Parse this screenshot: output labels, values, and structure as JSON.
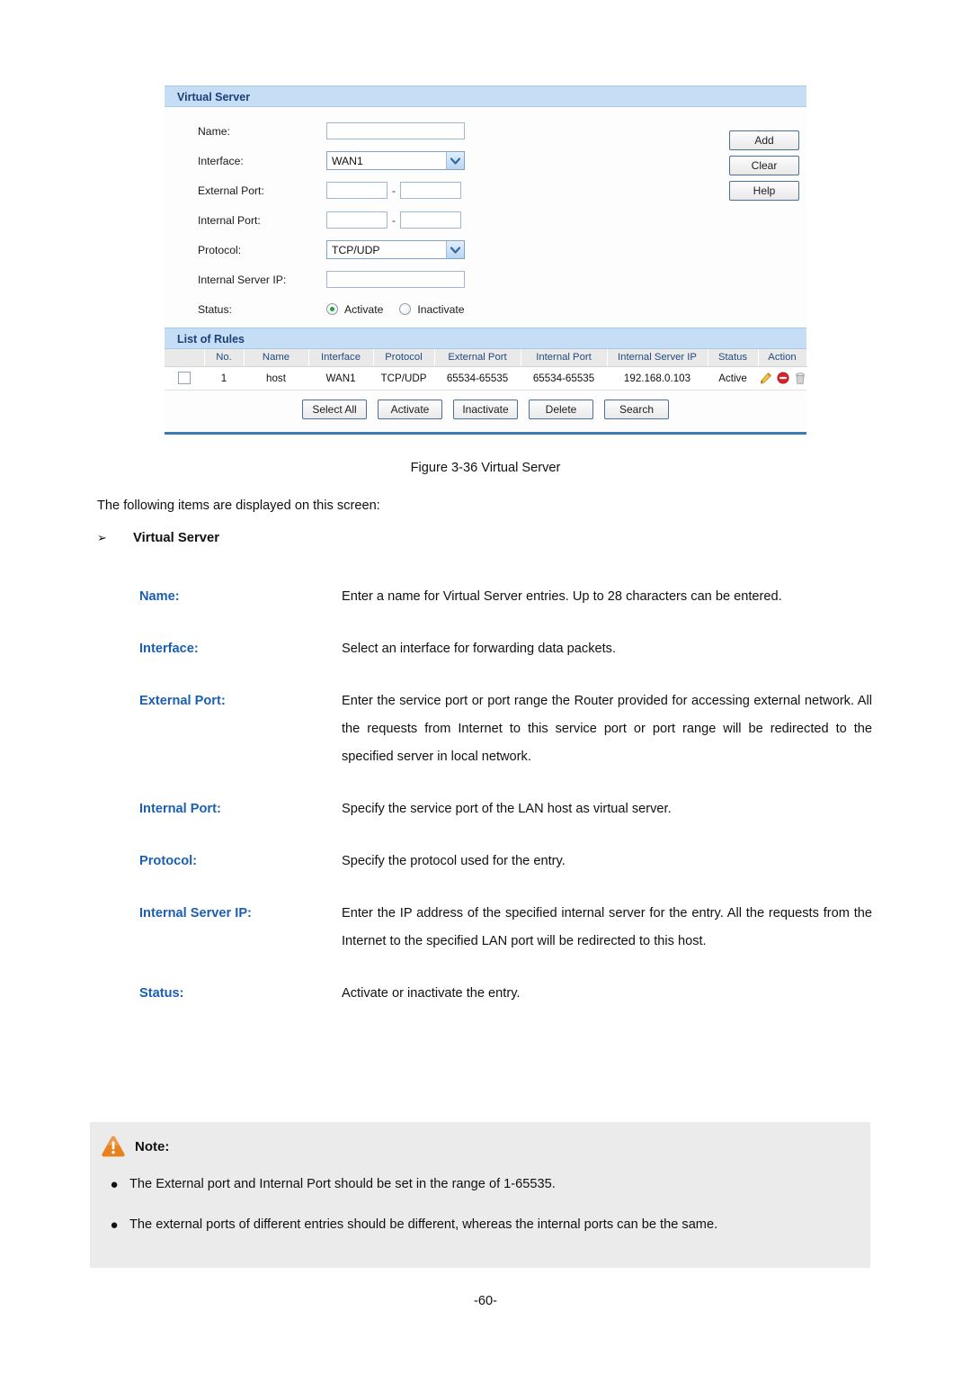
{
  "figure": {
    "panel_title": "Virtual Server",
    "form": {
      "name_label": "Name:",
      "name_value": "",
      "interface_label": "Interface:",
      "interface_value": "WAN1",
      "external_port_label": "External Port:",
      "external_port_from": "",
      "external_port_to": "",
      "internal_port_label": "Internal Port:",
      "internal_port_from": "",
      "internal_port_to": "",
      "protocol_label": "Protocol:",
      "protocol_value": "TCP/UDP",
      "internal_server_ip_label": "Internal Server IP:",
      "internal_server_ip_value": "",
      "status_label": "Status:",
      "status_activate": "Activate",
      "status_inactivate": "Inactivate",
      "status_selected": "Activate",
      "range_dash": "-"
    },
    "side_buttons": [
      {
        "label": "Add",
        "name": "add-button"
      },
      {
        "label": "Clear",
        "name": "clear-button"
      },
      {
        "label": "Help",
        "name": "help-button"
      }
    ],
    "list_title": "List of Rules",
    "table": {
      "columns": [
        "",
        "No.",
        "Name",
        "Interface",
        "Protocol",
        "External Port",
        "Internal Port",
        "Internal Server IP",
        "Status",
        "Action"
      ],
      "rows": [
        {
          "no": "1",
          "name": "host",
          "interface": "WAN1",
          "protocol": "TCP/UDP",
          "external_port": "65534-65535",
          "internal_port": "65534-65535",
          "internal_server_ip": "192.168.0.103",
          "status": "Active",
          "actions": [
            "edit-pencil-icon",
            "block-icon",
            "trash-icon"
          ]
        }
      ]
    },
    "table_buttons": [
      {
        "label": "Select All",
        "name": "select-all-button"
      },
      {
        "label": "Activate",
        "name": "activate-button"
      },
      {
        "label": "Inactivate",
        "name": "inactivate-button"
      },
      {
        "label": "Delete",
        "name": "delete-button"
      },
      {
        "label": "Search",
        "name": "search-button"
      }
    ],
    "caption": "Figure 3-36 Virtual Server"
  },
  "body": {
    "intro": "The following items are displayed on this screen:",
    "section_arrow": "➢",
    "section_title": "Virtual Server",
    "definitions": [
      {
        "term": "Name:",
        "desc": "Enter a name for Virtual Server entries. Up to 28 characters can be entered."
      },
      {
        "term": "Interface:",
        "desc": "Select an interface for forwarding data packets."
      },
      {
        "term": "External Port:",
        "desc": "Enter the service port or port range the Router provided for accessing external network. All the requests from Internet to this service port or port range will be redirected to the specified server in local network."
      },
      {
        "term": "Internal Port:",
        "desc": "Specify the service port of the LAN host as virtual server."
      },
      {
        "term": "Protocol:",
        "desc": "Specify the protocol used for the entry."
      },
      {
        "term": "Internal Server IP:",
        "desc": "Enter the IP address of the specified internal server for the entry. All the requests from the Internet to the specified LAN port will be redirected to this host."
      },
      {
        "term": "Status:",
        "desc": "Activate or inactivate the entry."
      }
    ]
  },
  "note": {
    "title": "Note:",
    "icon": "warning-triangle-icon",
    "bullet": "●",
    "items": [
      "The External port and Internal Port should be set in the range of 1-65535.",
      "The external ports of different entries should be different, whereas the internal ports can be the same."
    ]
  },
  "page_number": "-60-",
  "colors": {
    "panel_header_bg": "#c5ddf5",
    "panel_header_text": "#1d3f77",
    "table_header_bg": "#e9e9e9",
    "table_header_text": "#234a80",
    "term_blue": "#1a5fb4",
    "rule_line": "#3b7cb5",
    "note_bg": "#ebebeb",
    "warning_orange": "#e8821e",
    "radio_dot_green": "#2f9b3a"
  }
}
